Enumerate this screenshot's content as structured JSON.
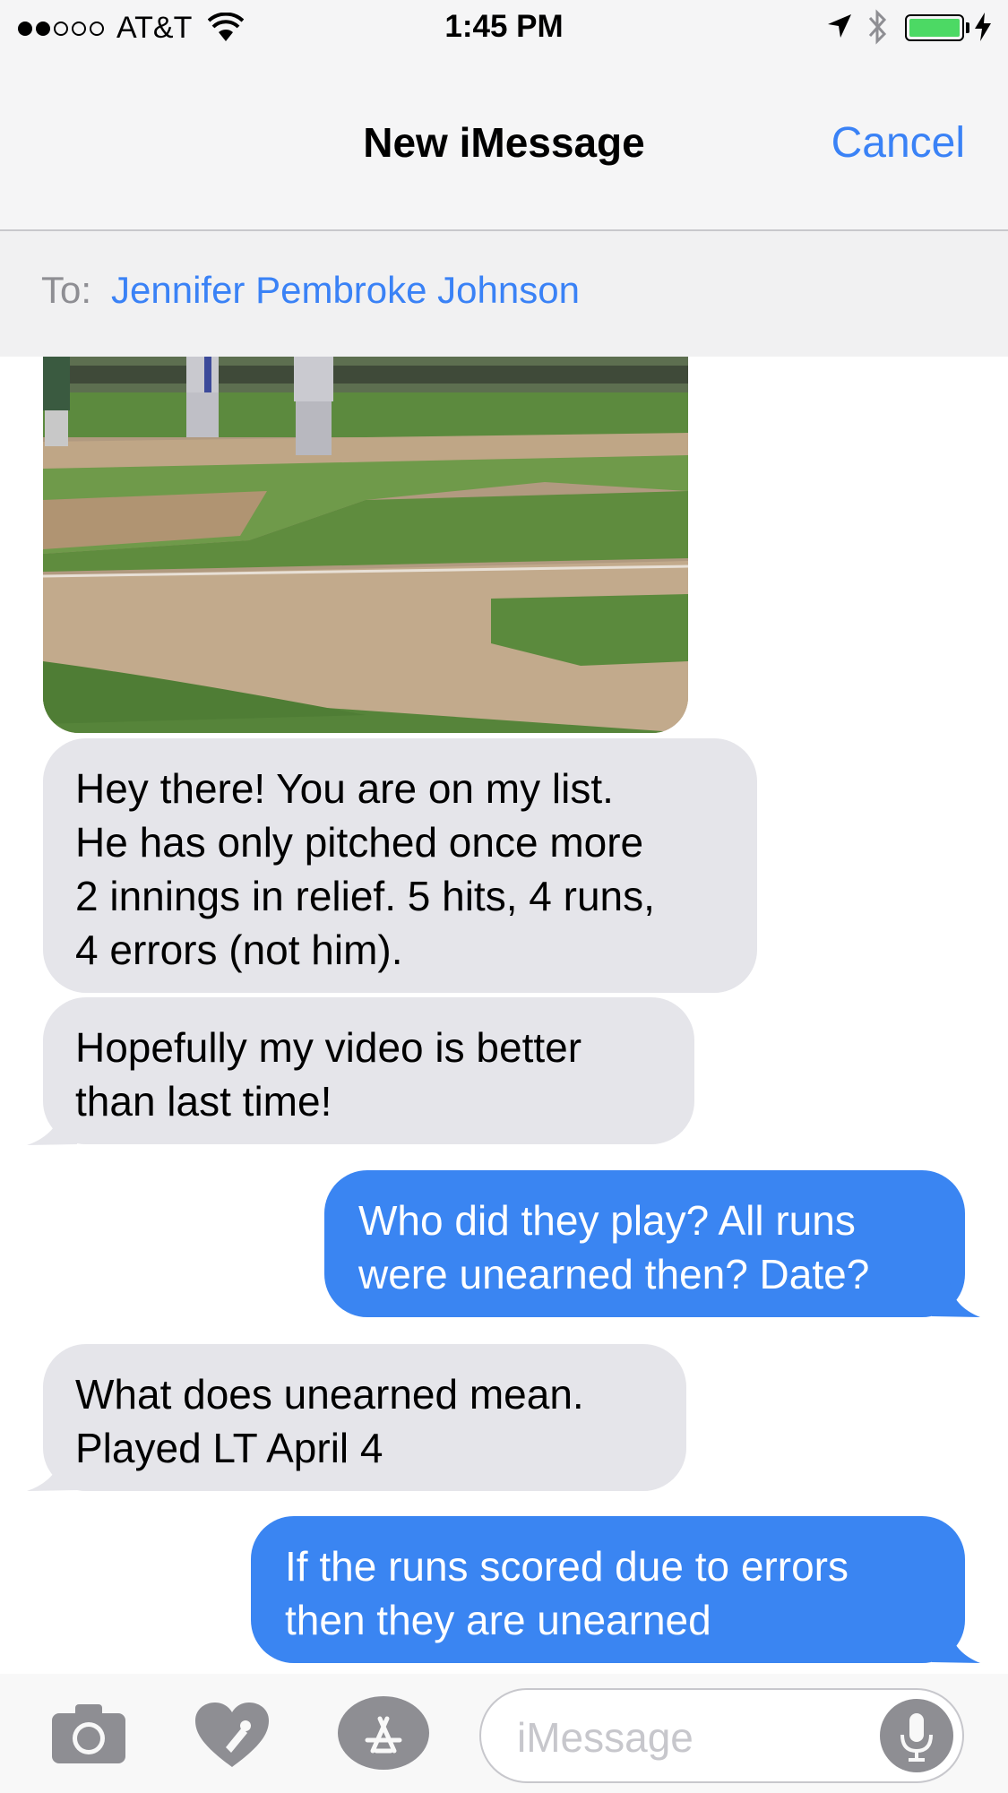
{
  "status_bar": {
    "carrier": "AT&T",
    "time": "1:45 PM",
    "signal_strength": "2 of 5",
    "battery_color": "#4cd964",
    "icons": [
      "wifi-icon",
      "location-arrow-icon",
      "bluetooth-icon",
      "battery-icon",
      "charging-bolt-icon"
    ]
  },
  "nav": {
    "title": "New iMessage",
    "cancel_label": "Cancel",
    "accent_color": "#3a82f6"
  },
  "recipient": {
    "label": "To:",
    "name": "Jennifer Pembroke Johnson"
  },
  "messages": [
    {
      "from": "them",
      "type": "video"
    },
    {
      "from": "them",
      "lines": [
        "Hey there!  You are on my list.",
        "He has only pitched once more",
        "2 innings in relief. 5 hits, 4 runs,",
        "4 errors (not him)."
      ]
    },
    {
      "from": "them",
      "lines": [
        "Hopefully my video is better",
        "than last time!"
      ]
    },
    {
      "from": "me",
      "lines": [
        "Who did they play? All runs",
        "were unearned then? Date?"
      ]
    },
    {
      "from": "them",
      "lines": [
        "What does unearned mean.",
        "Played LT April 4"
      ]
    },
    {
      "from": "me",
      "lines": [
        "If the runs scored due to errors",
        "then they are unearned"
      ]
    }
  ],
  "input_bar": {
    "placeholder": "iMessage",
    "icons": [
      "camera-icon",
      "digital-touch-heart-icon",
      "app-store-icon",
      "microphone-icon"
    ]
  }
}
